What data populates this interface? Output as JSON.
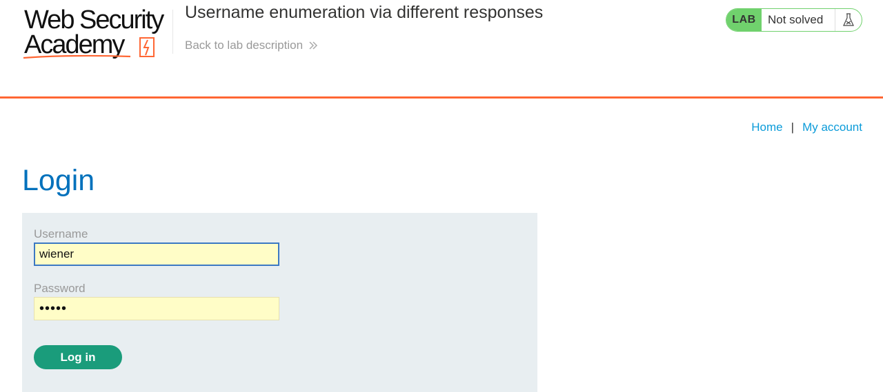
{
  "header": {
    "logo": {
      "line1": "Web Security",
      "line2": "Academy"
    },
    "lab_title": "Username enumeration via different responses",
    "back_link": "Back to lab description",
    "status": {
      "badge": "LAB",
      "text": "Not solved",
      "icon": "flask-icon"
    }
  },
  "nav": {
    "home": "Home",
    "separator": "|",
    "account": "My account"
  },
  "login": {
    "title": "Login",
    "username_label": "Username",
    "username_value": "wiener",
    "password_label": "Password",
    "password_value": "•••••",
    "submit_label": "Log in"
  },
  "colors": {
    "accent_orange": "#ff6633",
    "link_blue": "#0b9bd9",
    "title_blue": "#0071bc",
    "lab_green": "#70d16d",
    "button_green": "#1a9c7b",
    "panel_bg": "#e8eef1",
    "input_bg": "#fffdc7"
  }
}
